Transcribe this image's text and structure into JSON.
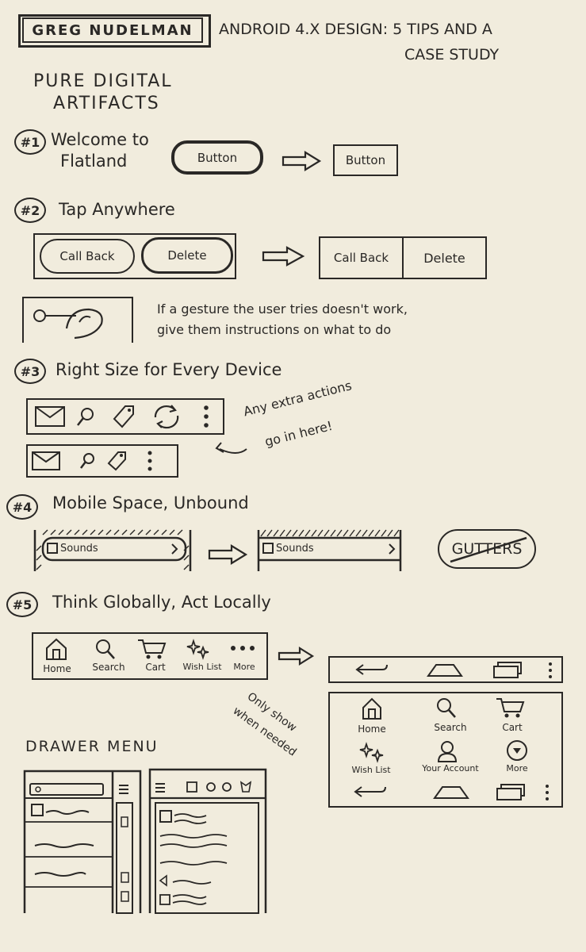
{
  "author_name": "GREG NUDELMAN",
  "talk_title_line1": "ANDROID 4.X DESIGN: 5 TIPS AND A",
  "talk_title_line2": "CASE STUDY",
  "section_heading_line1": "PURE DIGITAL",
  "section_heading_line2": "ARTIFACTS",
  "tip1": {
    "number": "#1",
    "title_line1": "Welcome to",
    "title_line2": "Flatland",
    "button_before": "Button",
    "button_after": "Button"
  },
  "tip2": {
    "number": "#2",
    "title": "Tap Anywhere",
    "callback_label": "Call Back",
    "delete_label": "Delete",
    "gesture_note_line1": "If a gesture the user tries doesn't work,",
    "gesture_note_line2": "give them instructions on what to do"
  },
  "tip3": {
    "number": "#3",
    "title": "Right Size for Every Device",
    "overflow_note_line1": "Any extra actions",
    "overflow_note_line2": "go in here!"
  },
  "tip4": {
    "number": "#4",
    "title": "Mobile Space, Unbound",
    "list_item_label": "Sounds",
    "gutters_label": "GUTTERS"
  },
  "tip5": {
    "number": "#5",
    "title": "Think Globally, Act Locally",
    "tabs": [
      "Home",
      "Search",
      "Cart",
      "Wish List",
      "More"
    ],
    "only_show_line1": "Only show",
    "only_show_line2": "when needed",
    "menu_items": [
      "Home",
      "Search",
      "Cart",
      "Wish List",
      "Your Account",
      "More"
    ]
  },
  "drawer_heading": "DRAWER MENU",
  "icons": [
    "mail-icon",
    "search-icon",
    "tag-icon",
    "refresh-icon",
    "overflow-icon",
    "home-icon",
    "cart-icon",
    "wishlist-icon",
    "back-icon",
    "account-icon"
  ]
}
